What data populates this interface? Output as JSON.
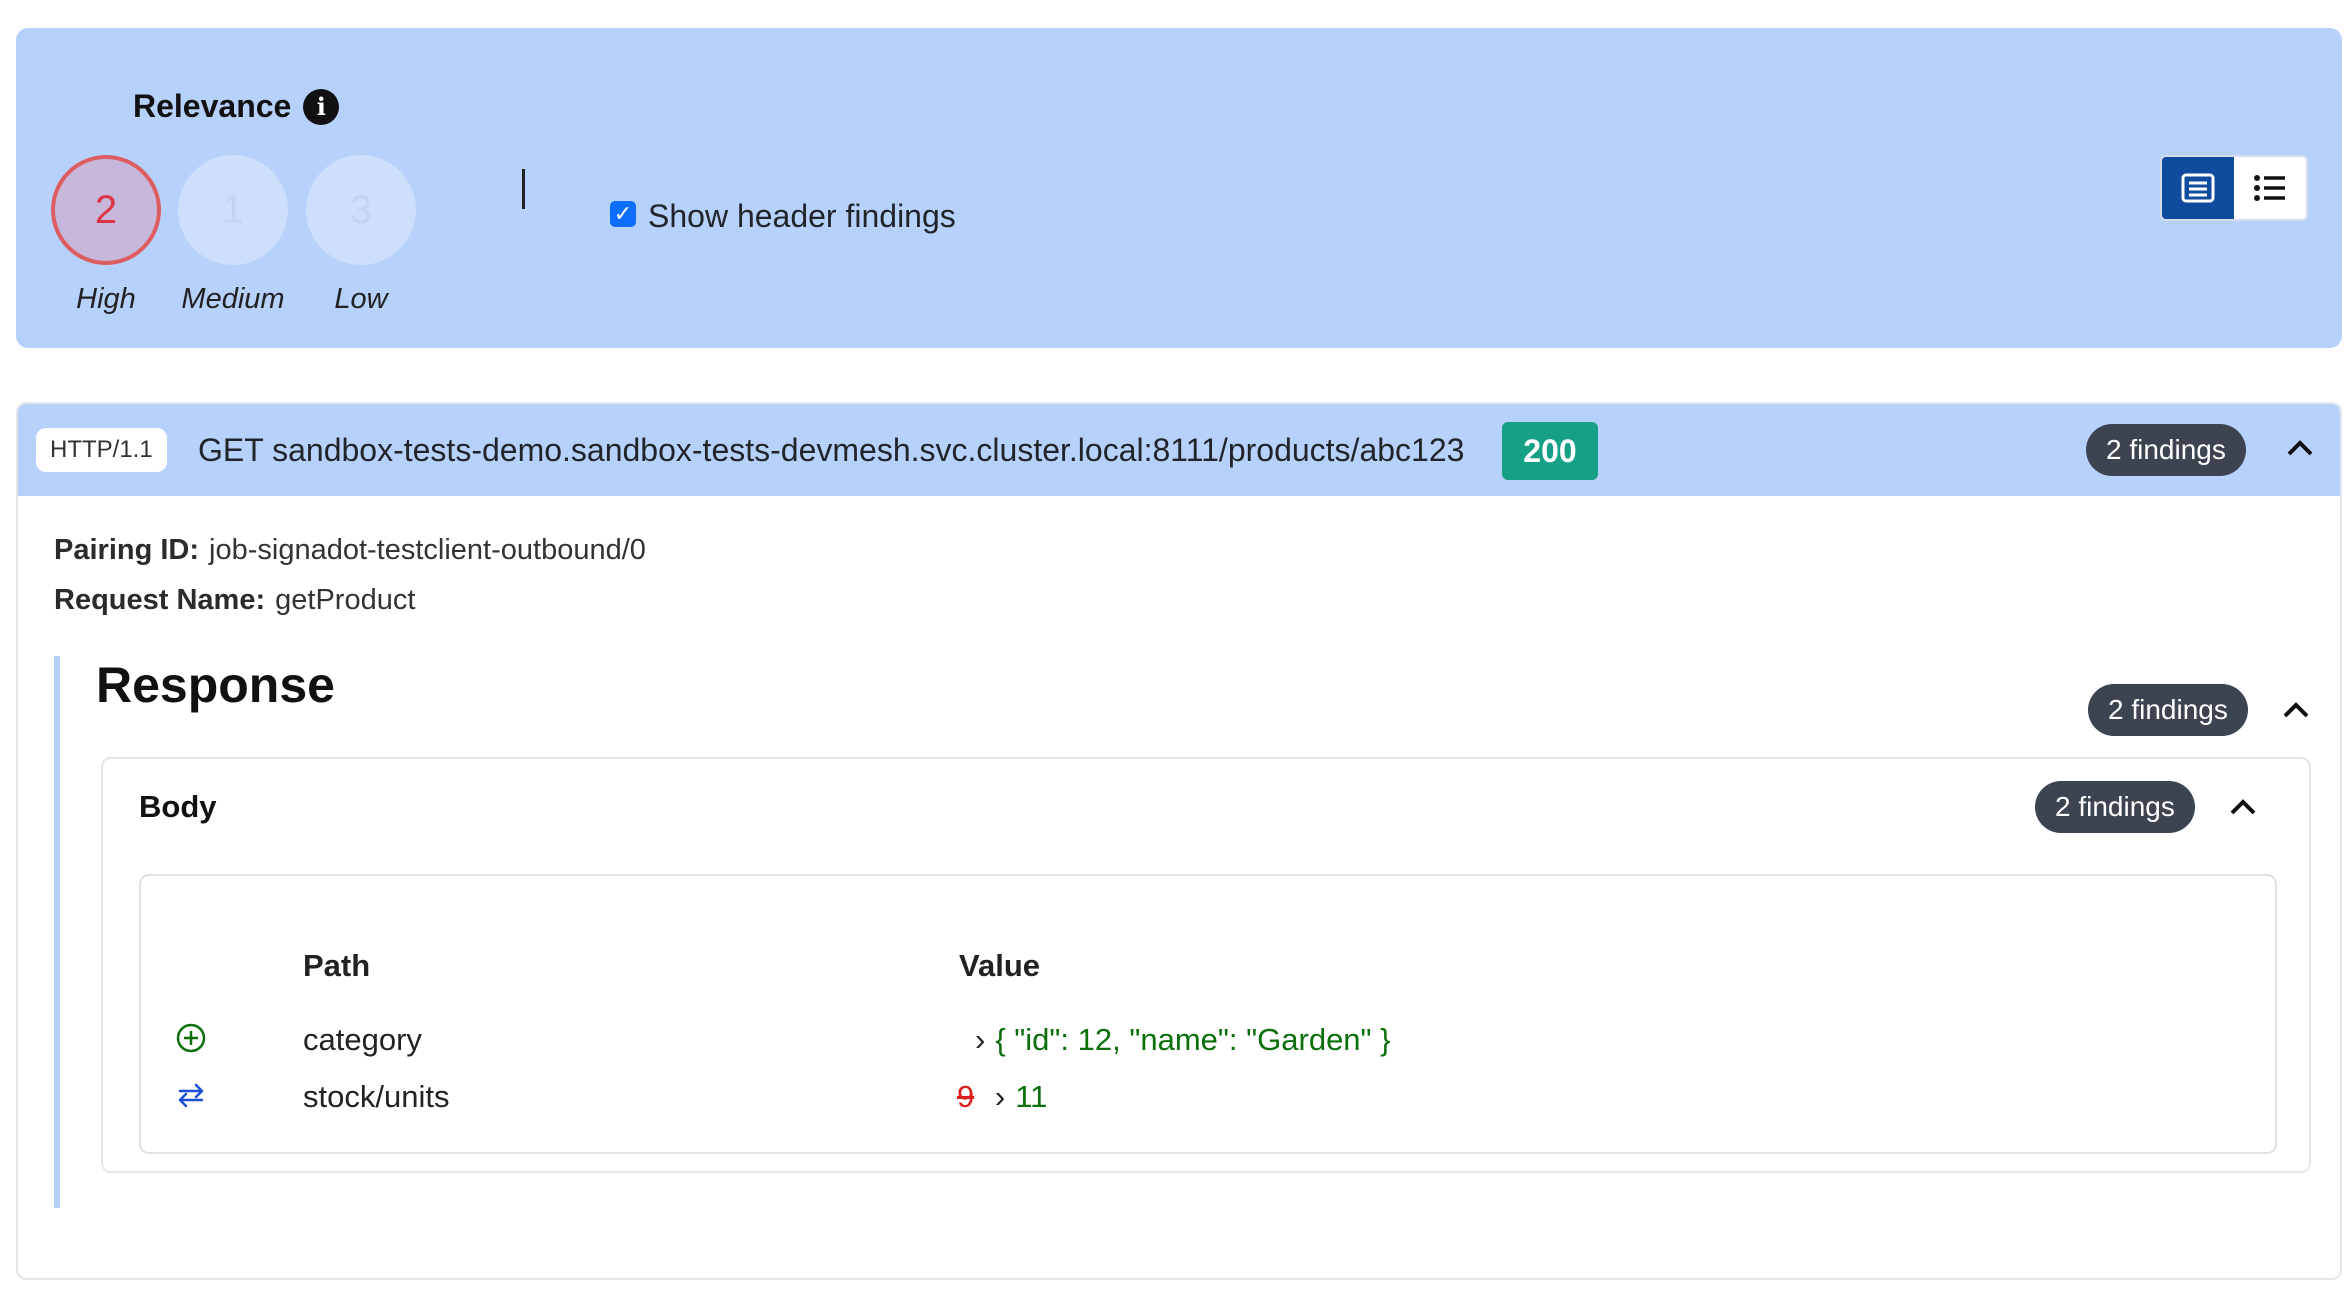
{
  "relevance": {
    "title": "Relevance",
    "levels": [
      {
        "count": "2",
        "label": "High"
      },
      {
        "count": "1",
        "label": "Medium"
      },
      {
        "count": "3",
        "label": "Low"
      }
    ],
    "show_header_findings": {
      "label": "Show header findings",
      "checked": true
    }
  },
  "request": {
    "protocol": "HTTP/1.1",
    "line": "GET sandbox-tests-demo.sandbox-tests-devmesh.svc.cluster.local:8111/products/abc123",
    "status": "200",
    "findings": "2 findings",
    "pairing_label": "Pairing ID:",
    "pairing_value": "job-signadot-testclient-outbound/0",
    "name_label": "Request Name:",
    "name_value": "getProduct"
  },
  "response": {
    "title": "Response",
    "findings": "2 findings",
    "body": {
      "title": "Body",
      "findings": "2 findings",
      "columns": {
        "path": "Path",
        "value": "Value"
      },
      "rows": [
        {
          "type": "added",
          "icon": "plus-circle-icon",
          "path": "category",
          "new_value": "{ \"id\": 12, \"name\": \"Garden\" }"
        },
        {
          "type": "changed",
          "icon": "swap-arrows-icon",
          "path": "stock/units",
          "old_value": "9",
          "new_value": "11"
        }
      ]
    }
  },
  "colors": {
    "panel_bg": "#b6d1fb",
    "status_ok": "#16a085",
    "pill_dark": "#3c4452",
    "added_green": "#0b6f0b",
    "removed_red": "#e02020",
    "high_red": "#dc3545"
  }
}
